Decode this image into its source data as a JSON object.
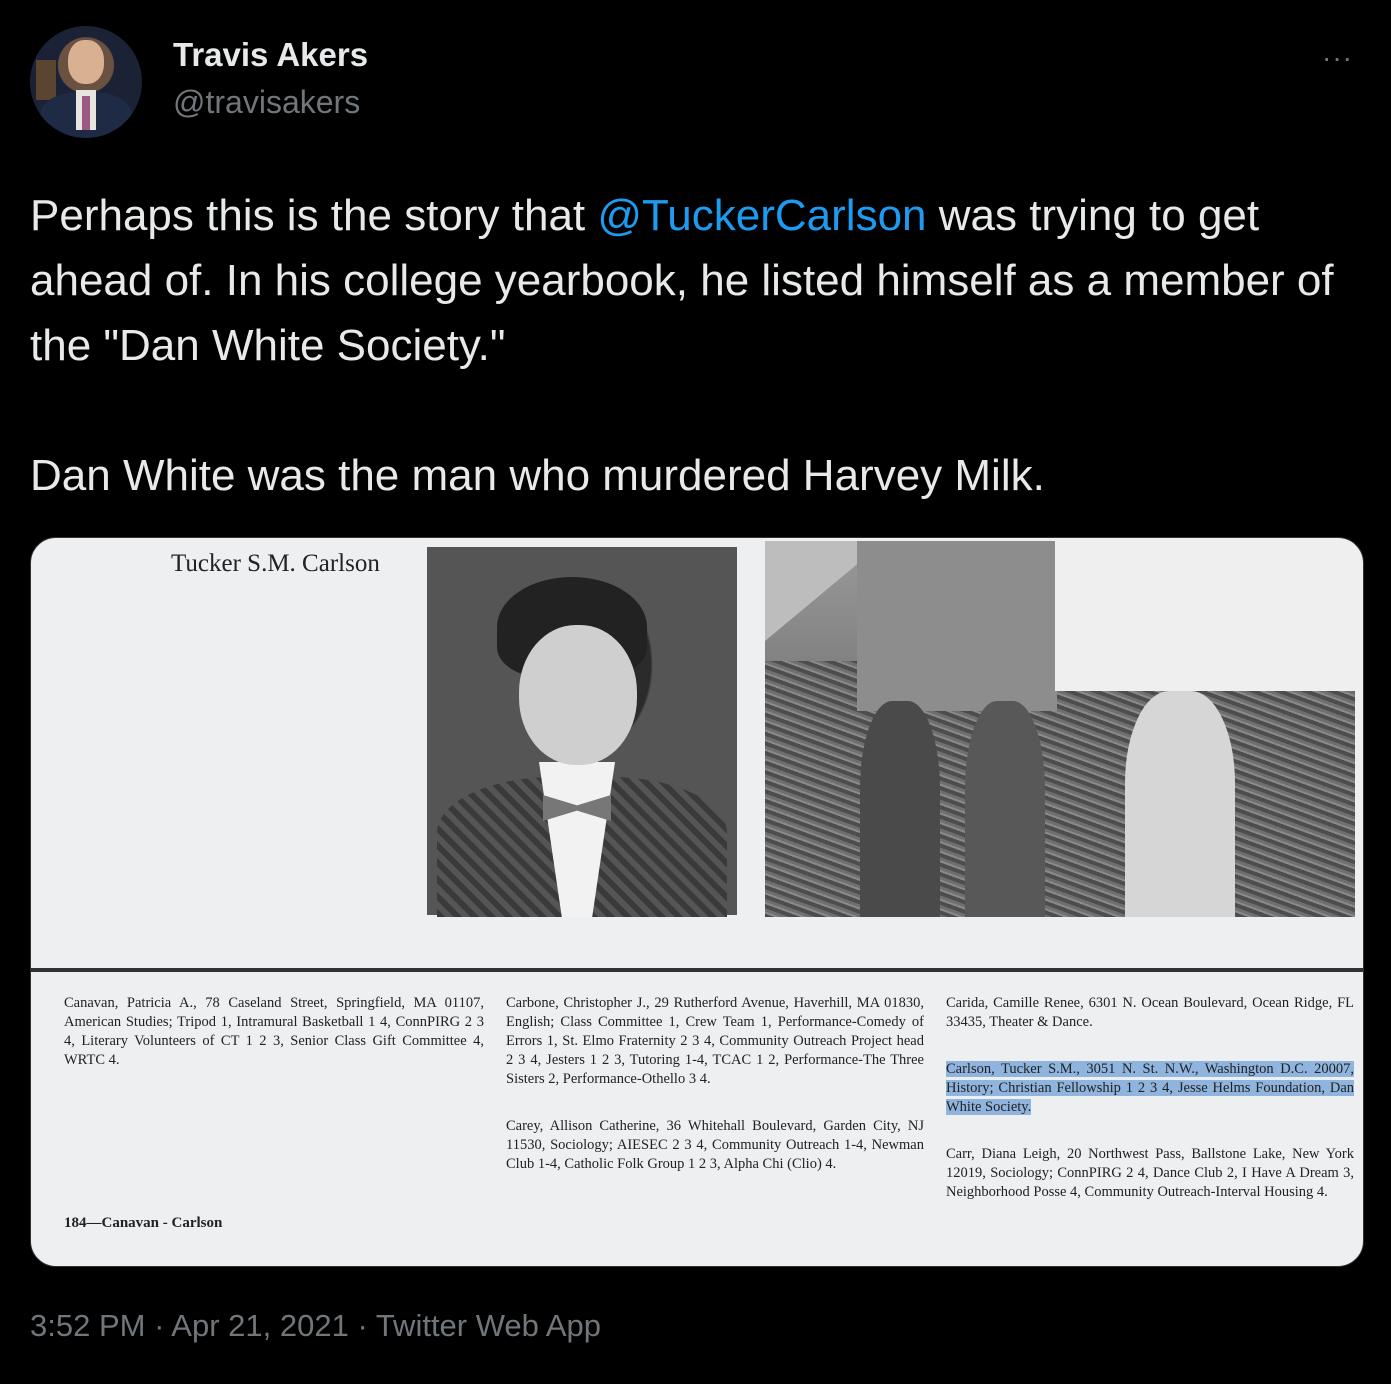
{
  "author": {
    "name": "Travis Akers",
    "handle": "@travisakers",
    "avatar_icon": "avatar-photo"
  },
  "more_icon": "ellipsis-icon",
  "more_label": "···",
  "tweet": {
    "line1_before": "Perhaps this is the story that ",
    "mention": "@TuckerCarlson",
    "line1_after": " was trying to get ahead of. In his college yearbook, he listed himself as a member of the \"Dan White Society.\"",
    "paragraph2": "Dan White was the man who murdered Harvey Milk."
  },
  "yearbook": {
    "name_caption": "Tucker S.M. Carlson",
    "col1": [
      "Canavan, Patricia A., 78 Caseland Street, Springfield, MA 01107, American Studies; Tripod 1, Intramural Basketball 1 4, ConnPIRG 2 3 4, Literary Volunteers of CT 1 2 3, Senior Class Gift Committee 4, WRTC 4."
    ],
    "col2": [
      "Carbone, Christopher J., 29 Rutherford Avenue, Haverhill, MA 01830, English; Class Committee 1, Crew Team 1, Performance-Comedy of Errors 1, St. Elmo Fraternity 2 3 4, Community Outreach Project head 2 3 4, Jesters 1 2 3, Tutoring 1-4, TCAC 1 2, Performance-The Three Sisters 2, Performance-Othello 3 4.",
      "Carey, Allison Catherine, 36 Whitehall Boulevard, Garden City, NJ 11530, Sociology; AIESEC 2 3 4, Community Outreach 1-4, Newman Club 1-4, Catholic Folk Group 1 2 3, Alpha Chi (Clio) 4."
    ],
    "col3_entry1": "Carida, Camille Renee, 6301 N. Ocean Boulevard, Ocean Ridge, FL 33435, Theater & Dance.",
    "col3_highlight": "Carlson, Tucker S.M., 3051 N. St. N.W., Washington D.C. 20007, History; Christian Fellowship 1 2 3 4, Jesse Helms Foundation, Dan White Society.",
    "col3_entry3": "Carr, Diana Leigh, 20 Northwest Pass, Ballstone Lake, New York 12019, Sociology; ConnPIRG 2 4, Dance Club 2, I Have A Dream 3, Neighborhood Posse 4, Community Outreach-Interval Housing 4.",
    "page_caption": "184—Canavan - Carlson"
  },
  "meta": {
    "time": "3:52 PM",
    "sep": " · ",
    "date": "Apr 21, 2021",
    "source": "Twitter Web App"
  },
  "colors": {
    "background": "#000000",
    "text": "#e7e9ea",
    "secondary": "#71767b",
    "link": "#1d9bf0",
    "highlight": "#8fb4de"
  }
}
